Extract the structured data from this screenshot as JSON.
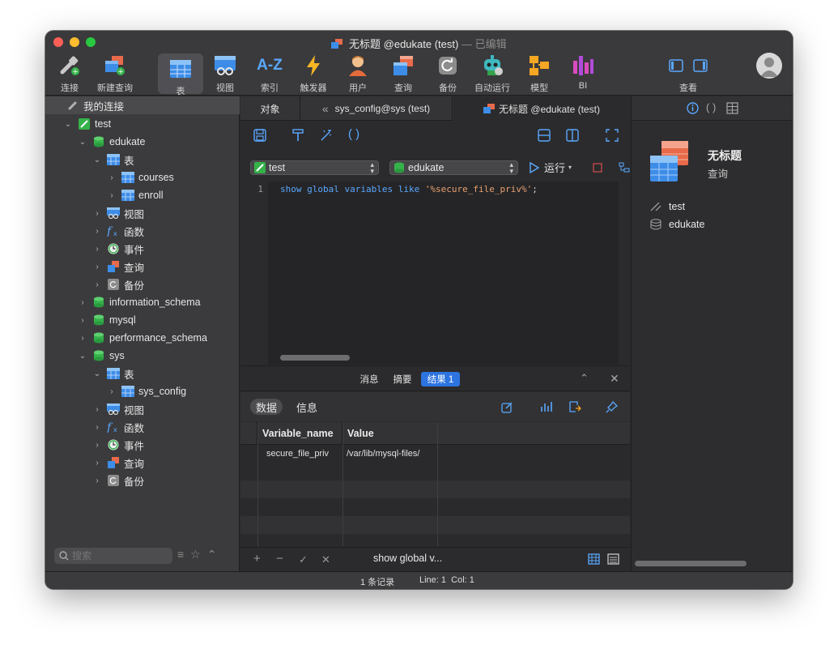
{
  "window": {
    "title": "无标题 @edukate (test)",
    "title_suffix": "— 已编辑"
  },
  "toolbar": {
    "items": [
      {
        "label": "连接",
        "icon": "connect-icon"
      },
      {
        "label": "新建查询",
        "icon": "new-query-icon"
      },
      {
        "label": "表",
        "icon": "table-icon"
      },
      {
        "label": "视图",
        "icon": "view-icon"
      },
      {
        "label": "索引",
        "icon": "index-icon",
        "glyph": "A-Z"
      },
      {
        "label": "触发器",
        "icon": "trigger-icon"
      },
      {
        "label": "用户",
        "icon": "user-icon"
      },
      {
        "label": "查询",
        "icon": "query-icon"
      },
      {
        "label": "备份",
        "icon": "backup-icon"
      },
      {
        "label": "自动运行",
        "icon": "automation-icon"
      },
      {
        "label": "模型",
        "icon": "model-icon"
      },
      {
        "label": "BI",
        "icon": "bi-icon"
      }
    ],
    "view_label": "查看"
  },
  "sidebar": {
    "header": "我的连接",
    "tree": [
      {
        "label": "test",
        "level": 0,
        "chevron": "⌄",
        "icon": "connection"
      },
      {
        "label": "edukate",
        "level": 1,
        "chevron": "⌄",
        "icon": "database"
      },
      {
        "label": "表",
        "level": 2,
        "chevron": "⌄",
        "icon": "table"
      },
      {
        "label": "courses",
        "level": 3,
        "chevron": "›",
        "icon": "table"
      },
      {
        "label": "enroll",
        "level": 3,
        "chevron": "›",
        "icon": "table"
      },
      {
        "label": "视图",
        "level": 2,
        "chevron": "›",
        "icon": "view"
      },
      {
        "label": "函数",
        "level": 2,
        "chevron": "›",
        "icon": "function"
      },
      {
        "label": "事件",
        "level": 2,
        "chevron": "›",
        "icon": "event"
      },
      {
        "label": "查询",
        "level": 2,
        "chevron": "›",
        "icon": "query"
      },
      {
        "label": "备份",
        "level": 2,
        "chevron": "›",
        "icon": "backup"
      },
      {
        "label": "information_schema",
        "level": 1,
        "chevron": "›",
        "icon": "database"
      },
      {
        "label": "mysql",
        "level": 1,
        "chevron": "›",
        "icon": "database"
      },
      {
        "label": "performance_schema",
        "level": 1,
        "chevron": "›",
        "icon": "database"
      },
      {
        "label": "sys",
        "level": 1,
        "chevron": "⌄",
        "icon": "database"
      },
      {
        "label": "表",
        "level": 2,
        "chevron": "⌄",
        "icon": "table"
      },
      {
        "label": "sys_config",
        "level": 3,
        "chevron": "›",
        "icon": "table"
      },
      {
        "label": "视图",
        "level": 2,
        "chevron": "›",
        "icon": "view"
      },
      {
        "label": "函数",
        "level": 2,
        "chevron": "›",
        "icon": "function"
      },
      {
        "label": "事件",
        "level": 2,
        "chevron": "›",
        "icon": "event"
      },
      {
        "label": "查询",
        "level": 2,
        "chevron": "›",
        "icon": "query"
      },
      {
        "label": "备份",
        "level": 2,
        "chevron": "›",
        "icon": "backup"
      }
    ],
    "search_placeholder": "搜索"
  },
  "tabs": {
    "objects": "对象",
    "tab1": "sys_config@sys (test)",
    "tab2": "无标题 @edukate (test)"
  },
  "query": {
    "connection": "test",
    "database": "edukate",
    "run_label": "运行",
    "line_number": "1",
    "sql_keyword": "show global variables like ",
    "sql_string": "'%secure_file_priv%'",
    "sql_end": ";"
  },
  "results": {
    "tabs": [
      "消息",
      "摘要",
      "结果 1"
    ],
    "data_tab": "数据",
    "info_tab": "信息",
    "columns": [
      "Variable_name",
      "Value"
    ],
    "rows": [
      [
        "secure_file_priv",
        "/var/lib/mysql-files/"
      ]
    ],
    "bottom_sql": "show global v..."
  },
  "info_panel": {
    "title": "无标题",
    "subtitle": "查询",
    "connection": "test",
    "database": "edukate"
  },
  "status": {
    "records": "1 条记录",
    "position": "Line: 1  Col: 1"
  }
}
